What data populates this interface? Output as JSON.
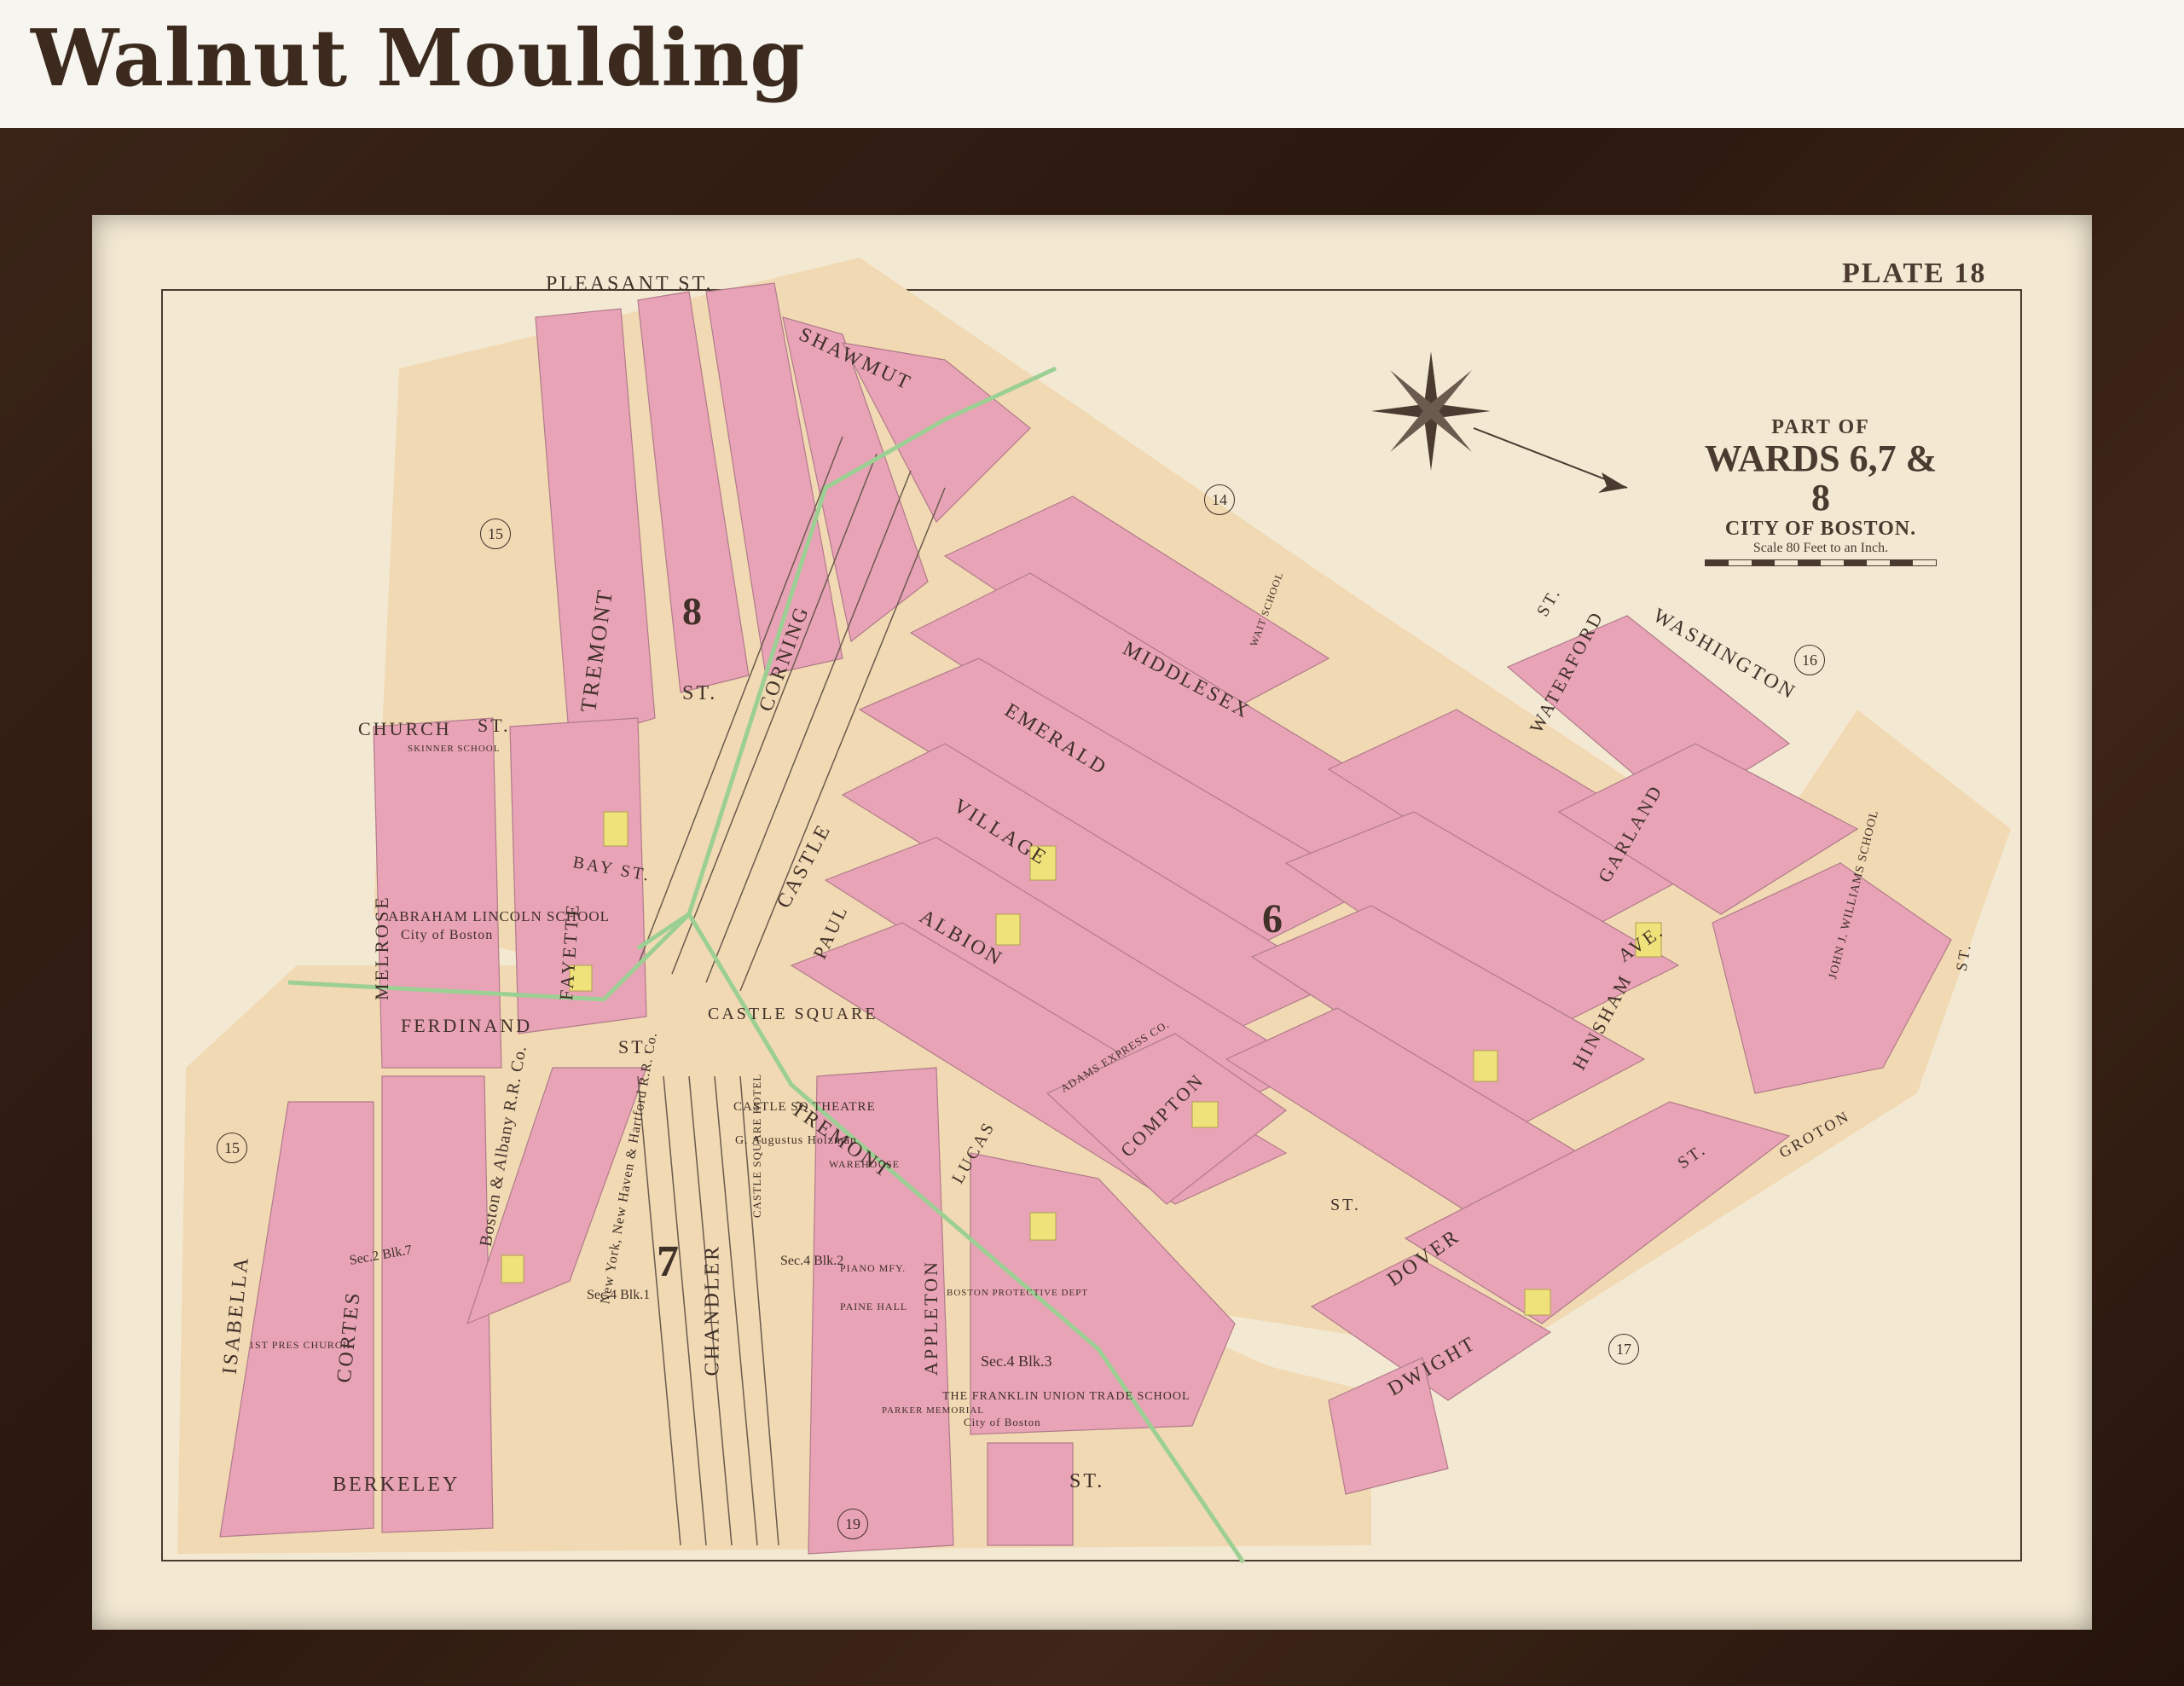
{
  "page": {
    "title": "Walnut Moulding"
  },
  "map": {
    "plate_label": "PLATE 18",
    "cartouche": {
      "line1": "PART OF",
      "line2": "WARDS 6,7 & 8",
      "line3": "CITY OF BOSTON.",
      "line4": "Scale 80 Feet to an Inch."
    },
    "colors": {
      "frame": "#2f1b10",
      "paper": "#f3e9d3",
      "block_pink": "#e9a3b6",
      "street": "#f1d9b3",
      "yellow_lot": "#efe27a",
      "green_line": "#9ccf93",
      "ink": "#4a3a30"
    },
    "streets": [
      "PLEASANT ST.",
      "SHAWMUT",
      "ST.",
      "CHURCH",
      "ST.",
      "TREMONT",
      "CORNING",
      "MIDDLESEX",
      "EMERALD",
      "VILLAGE",
      "CASTLE",
      "ALBION",
      "PAUL",
      "MELROSE",
      "FAYETTE",
      "BAY ST.",
      "FERDINAND",
      "ST.",
      "CASTLE SQUARE",
      "TREMONT",
      "ISABELLA",
      "CORTES",
      "CHANDLER",
      "APPLETON",
      "BERKELEY",
      "ST.",
      "LUCAS",
      "COMPTON",
      "ST.",
      "HINSHAM",
      "DOVER",
      "ST.",
      "DWIGHT",
      "WASHINGTON",
      "WATERFORD",
      "GARLAND",
      "AVE.",
      "GROTON",
      "ST.",
      "ST."
    ],
    "buildings": [
      "ABRAHAM LINCOLN SCHOOL",
      "City of Boston",
      "CASTLE SQ THEATRE",
      "G. Augustus Holzman",
      "CASTLE SQUARE HOTEL",
      "WAREHOUSE",
      "PIANO MFY.",
      "PAINE HALL",
      "BOSTON PROTECTIVE DEPT",
      "THE FRANKLIN UNION TRADE SCHOOL",
      "City of Boston",
      "ADAMS EXPRESS CO.",
      "JOHN J. WILLIAMS SCHOOL",
      "WAIT SCHOOL",
      "1ST PRES CHURCH",
      "Boston & Albany R.R. Co.",
      "New York, New Haven & Hartford R.R. Co.",
      "SKINNER SCHOOL",
      "PARKER MEMORIAL"
    ],
    "block_labels": [
      "Sec.4 Blk.2",
      "Sec.4 Blk.1",
      "Sec.4 Blk.3",
      "Sec.2 Blk.7"
    ],
    "ward_numbers": [
      "8",
      "7",
      "6"
    ],
    "circled_numbers": [
      "15",
      "14",
      "16",
      "15",
      "17",
      "19"
    ]
  }
}
